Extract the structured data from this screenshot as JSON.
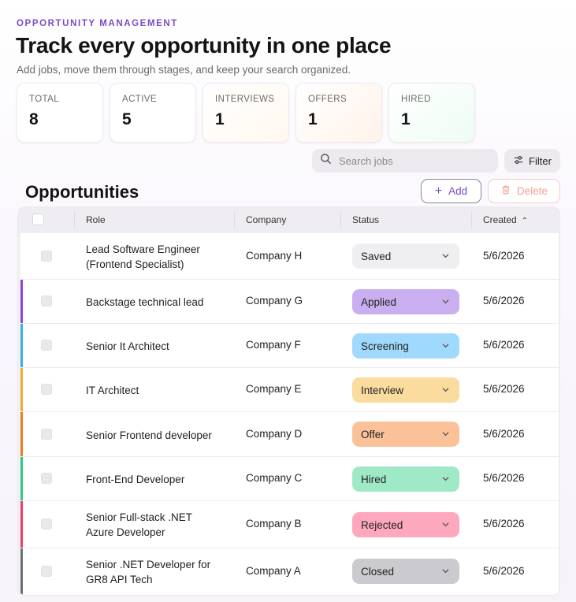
{
  "header": {
    "eyebrow": "OPPORTUNITY MANAGEMENT",
    "title": "Track every opportunity in one place",
    "subtitle": "Add jobs, move them through stages, and keep your search organized."
  },
  "stats": [
    {
      "label": "TOTAL",
      "value": "8"
    },
    {
      "label": "ACTIVE",
      "value": "5"
    },
    {
      "label": "INTERVIEWS",
      "value": "1"
    },
    {
      "label": "OFFERS",
      "value": "1"
    },
    {
      "label": "HIRED",
      "value": "1"
    }
  ],
  "toolbar": {
    "search_placeholder": "Search jobs",
    "filter_label": "Filter",
    "section_title": "Opportunities",
    "add_label": "Add",
    "delete_label": "Delete"
  },
  "table": {
    "columns": {
      "role": "Role",
      "company": "Company",
      "status": "Status",
      "created": "Created"
    },
    "sort_icon": "chevron-up-icon",
    "rows": [
      {
        "role": "Lead Software Engineer (Frontend Specialist)",
        "company": "Company H",
        "status": "Saved",
        "created": "5/6/2026",
        "status_color": "#efeef1",
        "accent_color": ""
      },
      {
        "role": "Backstage technical lead",
        "company": "Company G",
        "status": "Applied",
        "created": "5/6/2026",
        "status_color": "#c9aef0",
        "accent_color": "#8e44d6"
      },
      {
        "role": "Senior It Architect",
        "company": "Company F",
        "status": "Screening",
        "created": "5/6/2026",
        "status_color": "#9fd9fb",
        "accent_color": "#3aaee0"
      },
      {
        "role": "IT Architect",
        "company": "Company E",
        "status": "Interview",
        "created": "5/6/2026",
        "status_color": "#f9dc9e",
        "accent_color": "#f2aa30"
      },
      {
        "role": "Senior Frontend developer",
        "company": "Company D",
        "status": "Offer",
        "created": "5/6/2026",
        "status_color": "#fbc29a",
        "accent_color": "#f07a2a"
      },
      {
        "role": "Front-End Developer",
        "company": "Company C",
        "status": "Hired",
        "created": "5/6/2026",
        "status_color": "#9fe9c7",
        "accent_color": "#2ec986"
      },
      {
        "role": "Senior Full-stack .NET Azure Developer",
        "company": "Company B",
        "status": "Rejected",
        "created": "5/6/2026",
        "status_color": "#fda8bd",
        "accent_color": "#ee3d6b"
      },
      {
        "role": "Senior .NET Developer for GR8 API Tech",
        "company": "Company A",
        "status": "Closed",
        "created": "5/6/2026",
        "status_color": "#cbcacf",
        "accent_color": "#6f6e73"
      }
    ]
  },
  "colors": {
    "brand": "#7c4bc6",
    "delete": "#f0a397"
  }
}
